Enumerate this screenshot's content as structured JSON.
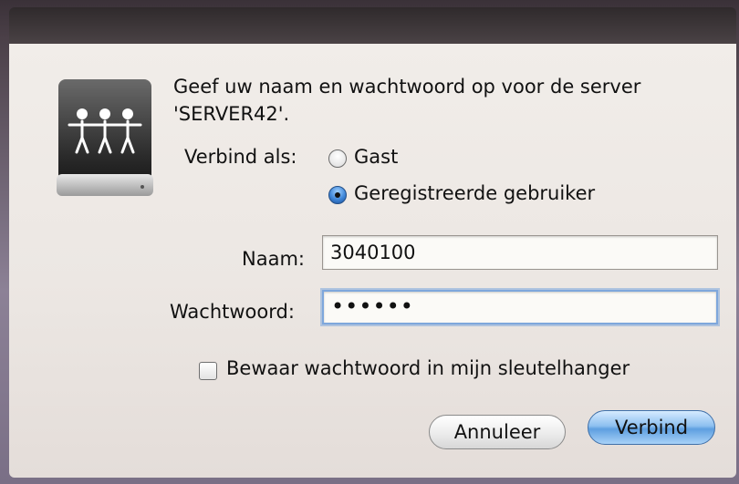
{
  "dialog": {
    "message": "Geef uw naam en wachtwoord op voor de server 'SERVER42'.",
    "connect_as_label": "Verbind als:",
    "options": [
      {
        "label": "Gast",
        "selected": false
      },
      {
        "label": "Geregistreerde gebruiker",
        "selected": true
      }
    ],
    "name_label": "Naam:",
    "name_value": "3040100",
    "password_label": "Wachtwoord:",
    "password_value": "••••••",
    "remember_label": "Bewaar wachtwoord in mijn sleutelhanger",
    "remember_checked": false,
    "cancel_label": "Annuleer",
    "connect_label": "Verbind"
  },
  "icons": {
    "server": "network-server-icon"
  },
  "colors": {
    "accent": "#5e9fe0",
    "dialog_bg": "#ece7e3"
  }
}
